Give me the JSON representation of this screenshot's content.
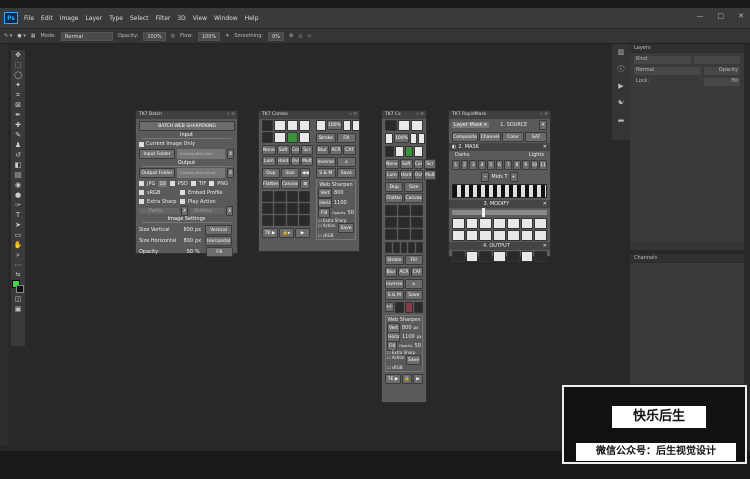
{
  "menubar": {
    "app": "Ps",
    "items": [
      "File",
      "Edit",
      "Image",
      "Layer",
      "Type",
      "Select",
      "Filter",
      "3D",
      "View",
      "Window",
      "Help"
    ],
    "win_min": "—",
    "win_max": "□",
    "win_close": "✕"
  },
  "options": {
    "mode_label": "Mode:",
    "mode_value": "Normal",
    "opacity_label": "Opacity:",
    "opacity_value": "100%",
    "flow_label": "Flow:",
    "flow_value": "100%",
    "smoothing_label": "Smoothing:",
    "smoothing_value": "0%"
  },
  "panels": {
    "layers_title": "Layers",
    "channels_title": "Channels",
    "layers_search": "Kind",
    "layers_mode": "Normal",
    "layers_opacity": "Opacity",
    "layers_lock": "Lock:",
    "layers_fill": "Fill"
  },
  "batch": {
    "title": "TK7 Batch",
    "header": "BATCH WEB SHARPENING",
    "input_label": "Input",
    "current_only": "Current Image Only",
    "input_folder": "Input Folder",
    "input_path": "~/Desktop/Batch/In/",
    "output_label": "Output",
    "output_folder": "Output Folder",
    "output_path": "~/Desktop/Batch/Out/",
    "jpg": "JPG",
    "jpg_q": "10",
    "psd": "PSD",
    "tif": "TIF",
    "png": "PNG",
    "srgb": "sRGB",
    "embed": "Embed Profile",
    "extra": "Extra Sharp",
    "play": "Play Action",
    "paths": "Paths",
    "xlabel": "X",
    "actfld": "Actions",
    "settings_label": "Image Settings",
    "size_v": "Size Vertical",
    "size_v_val": "800",
    "size_h": "Size Horizontal",
    "size_h_val": "800",
    "px": "px",
    "vertical": "Vertical",
    "horizontal": "Horizontal",
    "opacity": "Opacity",
    "opacity_val": "50",
    "pct": "%",
    "fill": "Fill"
  },
  "combo": {
    "title": "TK7 Combo",
    "pct100": "100%",
    "stroke": "Stroke",
    "fill": "Fill",
    "none": "None",
    "soft": "Soft",
    "col": "Col",
    "sc": "Scr",
    "blur": "Blur",
    "acr": "ACR",
    "caf": "CAF",
    "lum": "Lum",
    "hard": "Hard",
    "ovl": "Ovl",
    "mult": "Mult",
    "inverse": "Inverse",
    "xselect": "± Select",
    "dupimg": "Dup Img",
    "size": "Size",
    "flatten": "Flatten",
    "canvas": "Canvas",
    "sm": "S & M",
    "save": "Save",
    "web_sharpen": "Web Sharpen",
    "vert": "Vert",
    "vert_val": "800",
    "horiz": "Horiz",
    "horiz_val": "1100",
    "fill2": "Fill",
    "opac": "Opacity",
    "opac_val": "50",
    "extra": "Extra Sharp",
    "action": "Action",
    "srgb": "sRGB",
    "save2": "Save",
    "tk": "TK ▶"
  },
  "cx": {
    "title": "TK7 Cx",
    "pct100": "100%",
    "none": "None",
    "soft": "Soft",
    "col": "Col",
    "sc": "Scr",
    "lum": "Lum",
    "hard": "Hard",
    "ovl": "Ovl",
    "mult": "Mult",
    "dupimg": "Dup Img",
    "size": "Size",
    "flatten": "Flatten",
    "canvas": "Canvas",
    "stroke": "Stroke",
    "fill": "Fill",
    "blur": "Blur",
    "acr": "ACR",
    "caf": "CAF",
    "inverse": "Inverse",
    "xselect": "± Select",
    "sm": "S & M",
    "save": "Save",
    "web_sharpen": "Web Sharpen",
    "vert": "Vert",
    "vert_val": "800",
    "px": "px",
    "horiz": "Horiz",
    "horiz_val": "1100",
    "fill2": "Fill",
    "opac": "Opacity",
    "opac_val": "50",
    "extra": "Extra Sharp",
    "action": "Action",
    "srgb": "sRGB",
    "save2": "Save",
    "tk": "TK ▶"
  },
  "rapid": {
    "title": "TK7 RapidMask",
    "source_lbl": "1. SOURCE",
    "layer_mask": "Layer Mask ▾",
    "composite": "Composite",
    "channel": "Channel",
    "color": "Color",
    "sat": "SAT",
    "mask_lbl": "2. MASK",
    "darks": "Darks",
    "lights": "Lights",
    "midsT": "Mids T",
    "modify_lbl": "3. MODIFY",
    "output_lbl": "4. OUTPUT",
    "nums": [
      "1",
      "2",
      "3",
      "4",
      "5",
      "6",
      "7",
      "8",
      "9",
      "10",
      "11"
    ]
  },
  "overlay": {
    "line1": "快乐后生",
    "line2": "微信公众号：后生视觉设计"
  }
}
